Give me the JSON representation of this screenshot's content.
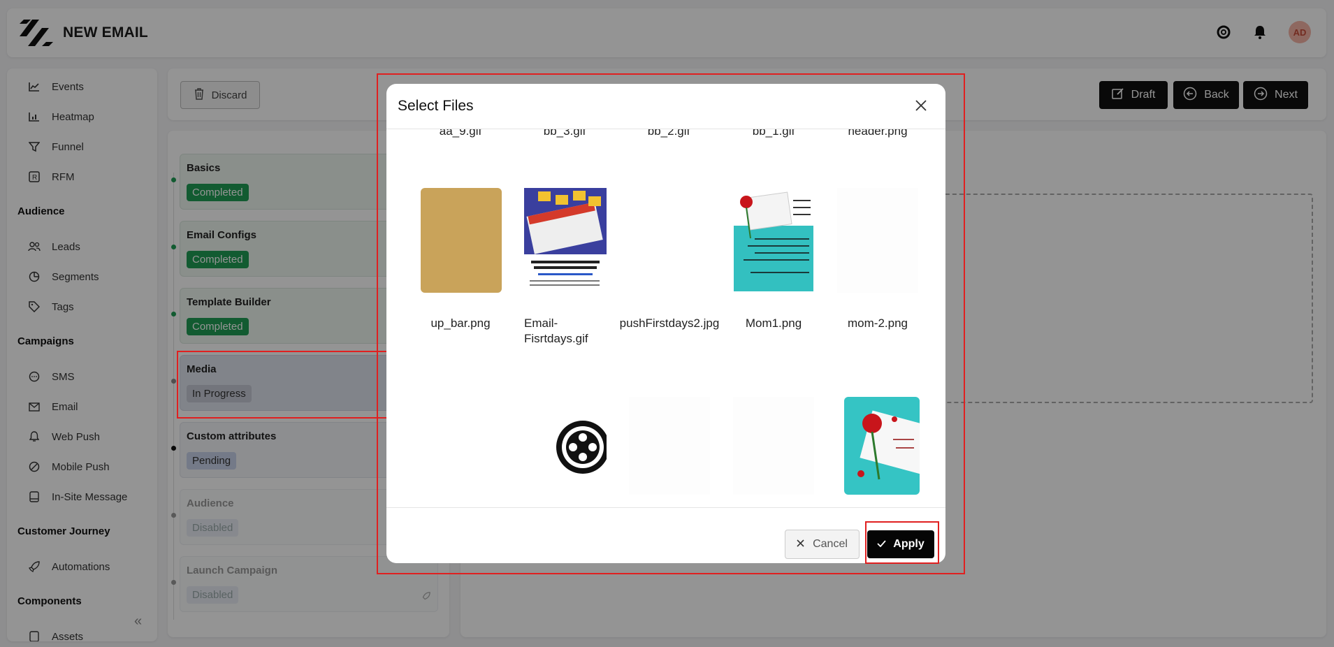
{
  "header": {
    "title": "NEW EMAIL",
    "avatar_initials": "AD"
  },
  "sidebar": {
    "items_top": [
      {
        "label": "Events",
        "icon": "line-chart-icon"
      },
      {
        "label": "Heatmap",
        "icon": "bar-chart-icon"
      },
      {
        "label": "Funnel",
        "icon": "funnel-icon"
      },
      {
        "label": "RFM",
        "icon": "rfm-icon"
      }
    ],
    "sections": {
      "audience": "Audience",
      "campaigns": "Campaigns",
      "customer_journey": "Customer Journey",
      "components": "Components"
    },
    "audience_items": [
      {
        "label": "Leads"
      },
      {
        "label": "Segments"
      },
      {
        "label": "Tags"
      }
    ],
    "campaign_items": [
      {
        "label": "SMS"
      },
      {
        "label": "Email"
      },
      {
        "label": "Web Push"
      },
      {
        "label": "Mobile Push"
      },
      {
        "label": "In-Site Message"
      }
    ],
    "journey_items": [
      {
        "label": "Automations"
      }
    ],
    "component_items": [
      {
        "label": "Assets"
      }
    ]
  },
  "toolbar": {
    "discard": "Discard",
    "draft": "Draft",
    "back": "Back",
    "next": "Next"
  },
  "steps": [
    {
      "title": "Basics",
      "status": "Completed"
    },
    {
      "title": "Email Configs",
      "status": "Completed"
    },
    {
      "title": "Template Builder",
      "status": "Completed"
    },
    {
      "title": "Media",
      "status": "In Progress"
    },
    {
      "title": "Custom attributes",
      "status": "Pending"
    },
    {
      "title": "Audience",
      "status": "Disabled"
    },
    {
      "title": "Launch Campaign",
      "status": "Disabled"
    }
  ],
  "modal": {
    "title": "Select Files",
    "cut_row": [
      "aa_9.gif",
      "bb_3.gif",
      "bb_2.gif",
      "bb_1.gif",
      "header.png"
    ],
    "row1": [
      "up_bar.png",
      "Email-Fisrtdays.gif",
      "pushFirstdays2.jpg",
      "Mom1.png",
      "mom-2.png"
    ],
    "cancel": "Cancel",
    "apply": "Apply"
  },
  "colors": {
    "completed": "#1f9d55",
    "highlight": "#e02020",
    "primary_button": "#111111"
  }
}
